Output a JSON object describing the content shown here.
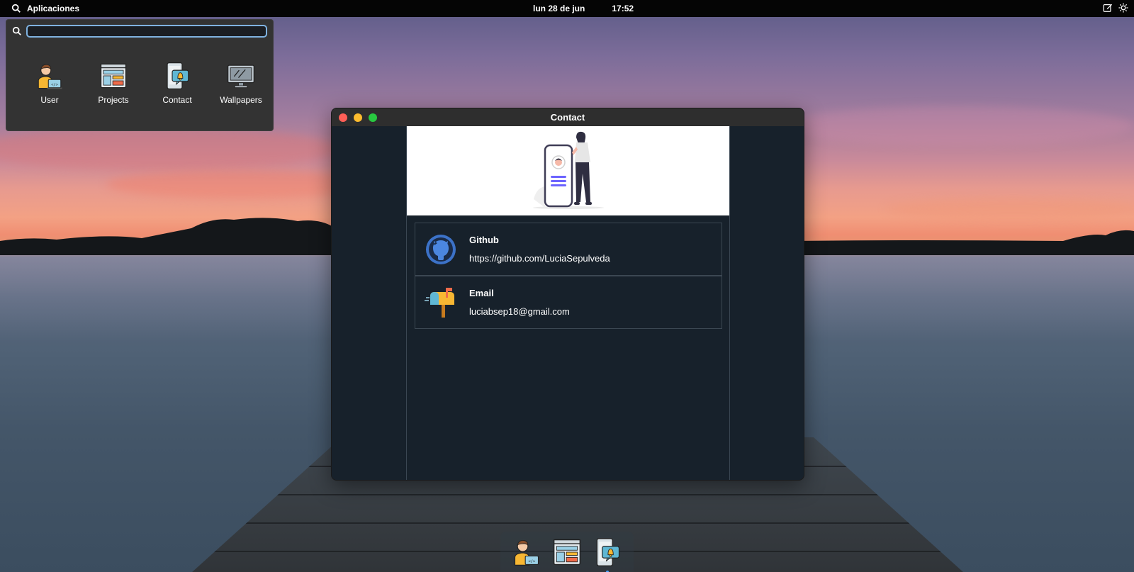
{
  "topbar": {
    "apps_label": "Aplicaciones",
    "date": "lun 28 de jun",
    "time": "17:52"
  },
  "launcher": {
    "search_value": "",
    "apps": [
      {
        "label": "User",
        "icon": "user-icon"
      },
      {
        "label": "Projects",
        "icon": "projects-icon"
      },
      {
        "label": "Contact",
        "icon": "contact-icon"
      },
      {
        "label": "Wallpapers",
        "icon": "wallpapers-icon"
      }
    ]
  },
  "window": {
    "title": "Contact",
    "traffic_colors": [
      "#ff5f57",
      "#febc2e",
      "#28c840"
    ],
    "contacts": [
      {
        "title": "Github",
        "value": "https://github.com/LuciaSepulveda",
        "icon": "github-icon"
      },
      {
        "title": "Email",
        "value": "luciabsep18@gmail.com",
        "icon": "mailbox-icon"
      }
    ]
  },
  "dock": {
    "items": [
      "user-icon",
      "projects-icon",
      "contact-icon"
    ],
    "active": "contact-icon"
  },
  "colors": {
    "topbar_bg": "#050505",
    "launcher_bg": "#333333",
    "search_focus": "#7fb2e0",
    "window_body": "#17212b",
    "accent": "#4aa3ff"
  }
}
